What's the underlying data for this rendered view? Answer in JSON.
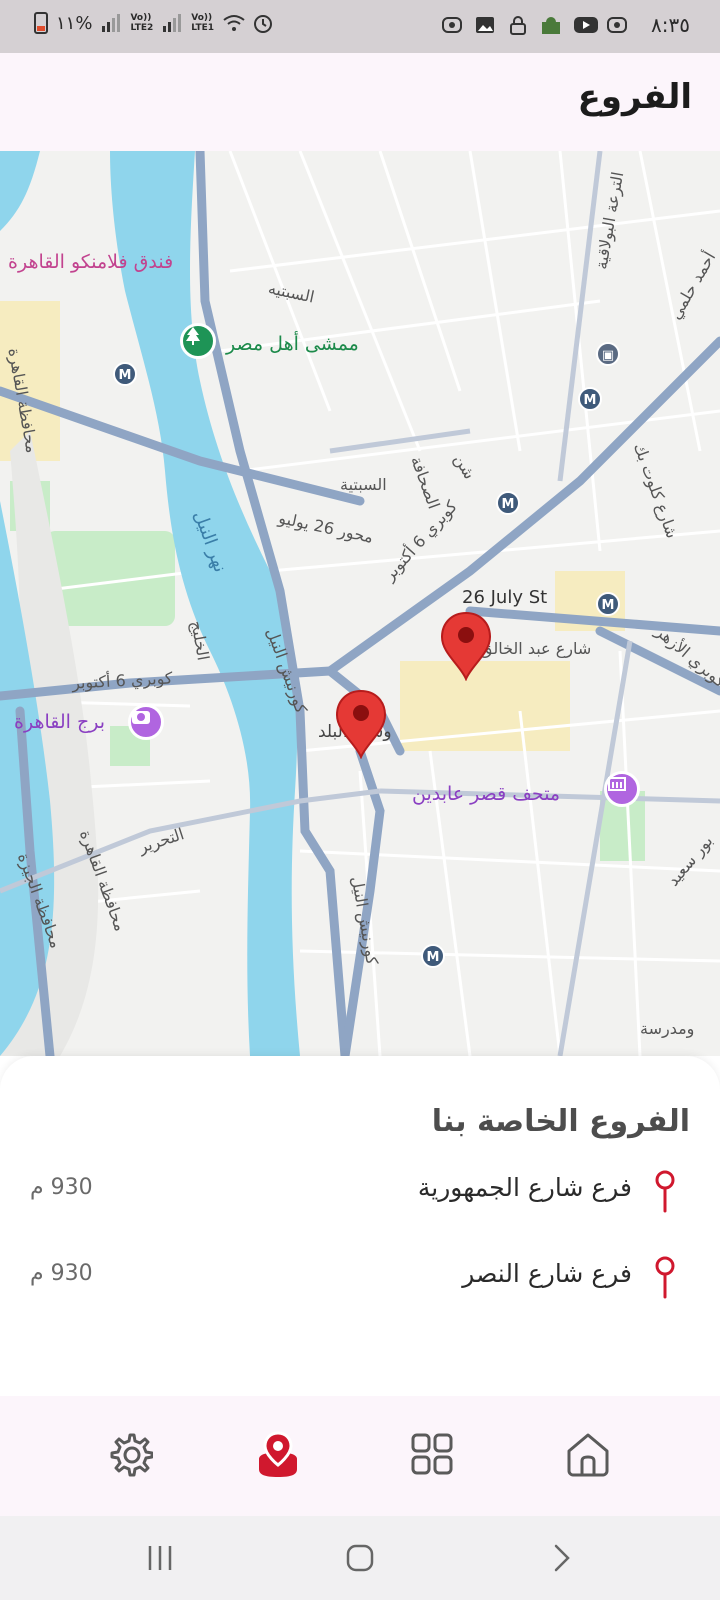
{
  "status_bar": {
    "time": "٨:٣٥",
    "battery": "١١%",
    "sim1": "LTE2",
    "sim2": "LTE1",
    "sim_prefix": "Vo))"
  },
  "header": {
    "title": "الفروع"
  },
  "map": {
    "labels": {
      "hotel": "فندق فلامنكو القاهرة",
      "walkway": "ممشى أهل مصر",
      "sabtia1": "السبتيه",
      "sabtia2": "السبتية",
      "sahafa": "الصحافة",
      "shan": "شن",
      "tura": "الترعة البولاقية",
      "ahmed_helmy": "أحمد حلمي",
      "koltbek": "شارع كلوت بك",
      "july26_axis": "محور 26 يوليو",
      "october_bridge": "كوبري 6 أكتوبر",
      "july26_st": "26 July St",
      "abdel_khaleq": "شارع عبد الخالق",
      "azhar": "كوبري الأزهر",
      "nile": "نهر النيل",
      "khalig": "الخليج",
      "corniche": "كورنيش النيل",
      "corniche2": "كورنيش النيل",
      "october_bridge2": "كوبري 6 أكتوبر",
      "cairo_tower": "برج القاهرة",
      "downtown": "وسط البلد",
      "abdeen": "متحف قصر عابدين",
      "tahrir": "التحرير",
      "cairo_gov": "محافظة القاهرة",
      "cairo_gov2": "محافظة القاهرة",
      "giza_gov": "محافظة الجيزة",
      "port_said": "بور سعيد",
      "sayeda": "ومدرسة"
    },
    "metro_label": "M"
  },
  "sheet": {
    "title": "الفروع الخاصة بنا",
    "branches": [
      {
        "name": "فرع شارع الجمهورية",
        "distance": "930 م"
      },
      {
        "name": "فرع شارع النصر",
        "distance": "930 م"
      }
    ]
  },
  "colors": {
    "accent": "#d0182e",
    "water": "#8fd5ec",
    "road": "#8fa5c4",
    "park": "#c8ecc8"
  },
  "nav": {
    "items": [
      {
        "name": "home",
        "icon": "home-icon"
      },
      {
        "name": "categories",
        "icon": "grid-icon"
      },
      {
        "name": "branches",
        "icon": "location-icon"
      },
      {
        "name": "settings",
        "icon": "gear-icon"
      }
    ]
  }
}
